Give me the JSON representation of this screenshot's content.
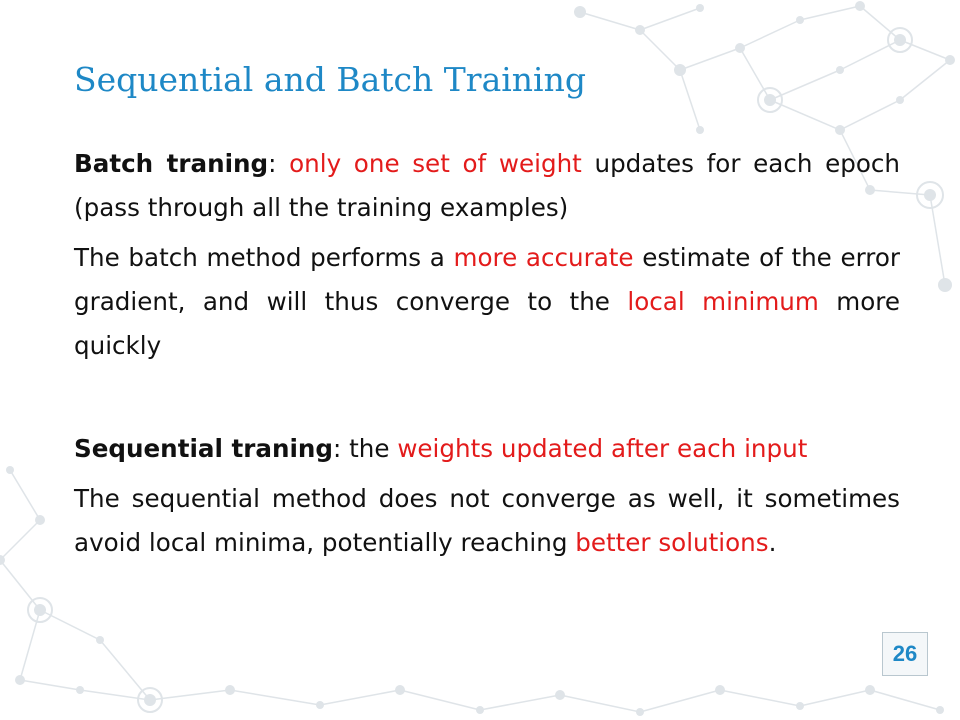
{
  "slide": {
    "title": "Sequential and Batch Training",
    "page_number": "26"
  },
  "content": {
    "batch_heading": "Batch traning",
    "batch_colon": ": ",
    "batch_highlight": "only one set of weight",
    "batch_rest": " updates for each epoch (pass through all the training examples)",
    "batch_detail_lead": "The batch method performs a ",
    "batch_detail_highlight": "more accurate",
    "batch_detail_mid": " estimate of the error gradient, and will thus converge to the ",
    "batch_detail_highlight2": "local minimum",
    "batch_detail_tail": " more quickly",
    "seq_heading": "Sequential traning",
    "seq_colon": ": the ",
    "seq_highlight": "weights updated after each input",
    "seq_detail_lead": "The sequential method does not converge as well, it sometimes avoid local minima, potentially reaching ",
    "seq_detail_highlight": "better solutions",
    "seq_detail_tail": "."
  },
  "colors": {
    "title": "#1e88c6",
    "highlight": "#e31b1b",
    "text": "#111111",
    "network_decoration": "#dfe4e8"
  },
  "decoration": {
    "icon": "network-graph-icon"
  }
}
